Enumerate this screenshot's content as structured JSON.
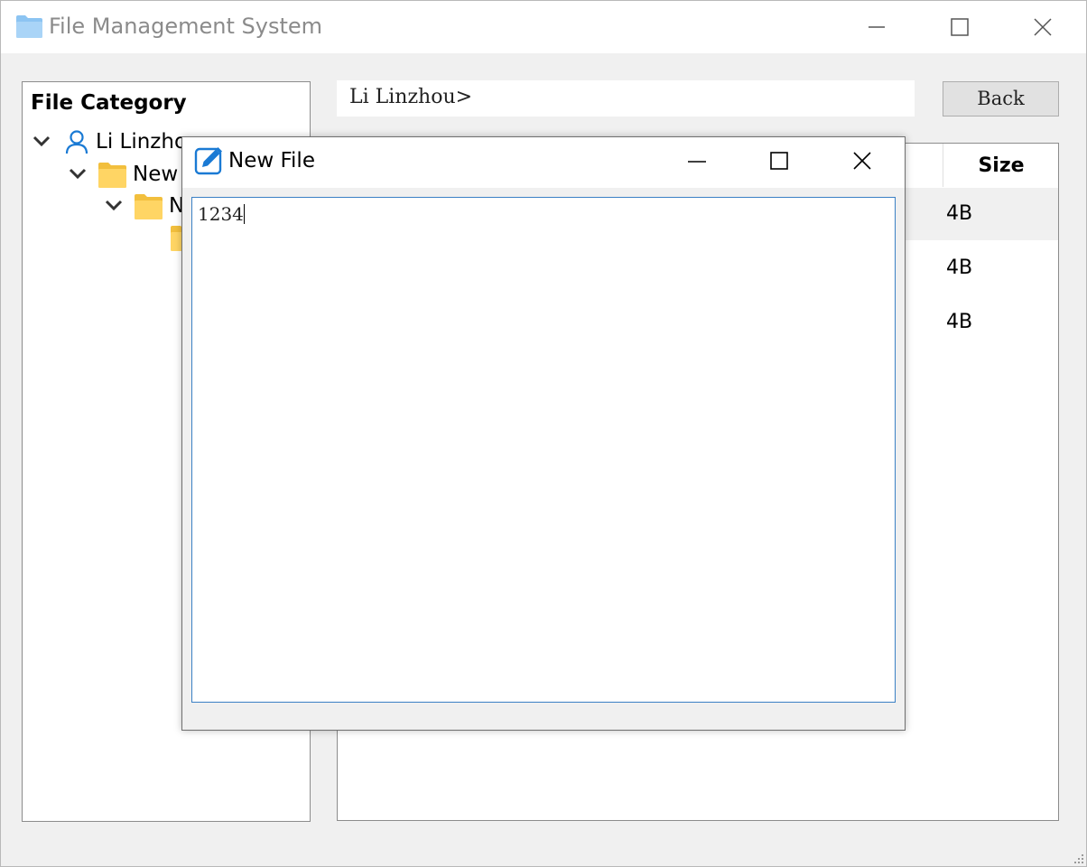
{
  "app": {
    "title": "File Management System",
    "icon": "folder-icon"
  },
  "tree": {
    "heading": "File Category",
    "nodes": [
      {
        "label": "Li Linzhou",
        "icon": "user-icon"
      },
      {
        "label": "New",
        "icon": "folder-icon"
      },
      {
        "label": "N",
        "icon": "folder-icon"
      },
      {
        "label": "",
        "icon": "folder-icon"
      }
    ]
  },
  "path_bar": {
    "text": "Li Linzhou>"
  },
  "toolbar": {
    "back_label": "Back"
  },
  "table": {
    "size_header": "Size",
    "rows": [
      {
        "size": "4B"
      },
      {
        "size": "4B"
      },
      {
        "size": "4B"
      }
    ]
  },
  "dialog": {
    "title": "New File",
    "icon": "pencil-edit-icon",
    "content": "1234"
  },
  "colors": {
    "accent": "#1a7ad4",
    "folder": "#ffd564",
    "focus_border": "#3a80c4"
  }
}
